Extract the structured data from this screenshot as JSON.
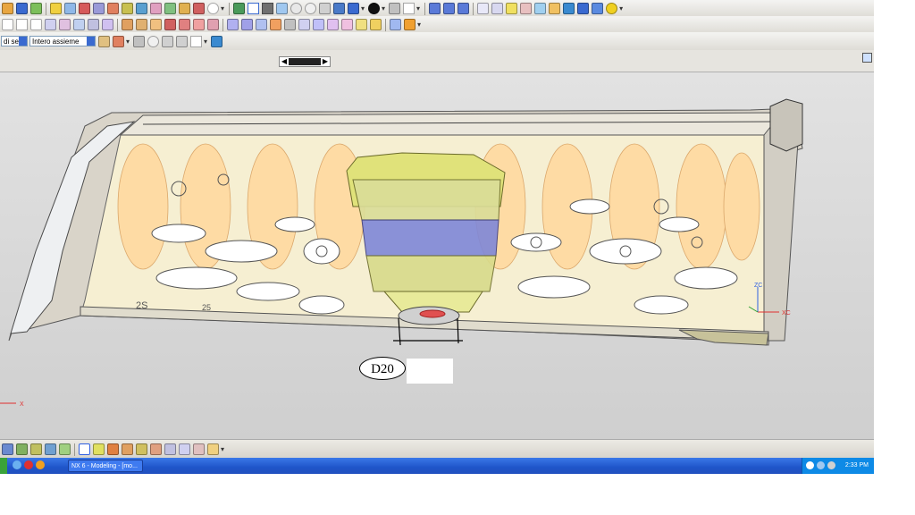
{
  "toolbar": {
    "selection_filter": "di sele",
    "assembly_scope": "Intero assieme"
  },
  "canvas": {
    "dimension_label": "D20",
    "axis_xc": "XC",
    "axis_zc": "ZC",
    "axis_x": "X",
    "part_marking_left": "2S",
    "part_marking_mid": "25"
  },
  "taskbar": {
    "task_label": "NX 6 - Modeling - [mo...",
    "clock": "2:33 PM"
  },
  "colors": {
    "part_cream": "#f6efd2",
    "part_rib": "#ffd9a0",
    "tool_yellow": "#e0e27a",
    "tool_blue": "#7f87d8",
    "taskbar_blue": "#2458d0"
  },
  "icons": [
    "new-icon",
    "open-icon",
    "save-icon",
    "undo-icon",
    "redo-icon",
    "cut-icon",
    "copy-icon",
    "paste-icon",
    "sketch-icon",
    "extrude-icon",
    "revolve-icon",
    "hole-icon",
    "blend-icon",
    "chamfer-icon",
    "shell-icon",
    "fit-icon",
    "zoom-icon",
    "rotate-icon",
    "pan-icon",
    "shaded-icon",
    "wireframe-icon",
    "color-icon",
    "layer-icon",
    "measure-icon",
    "analysis-icon"
  ]
}
